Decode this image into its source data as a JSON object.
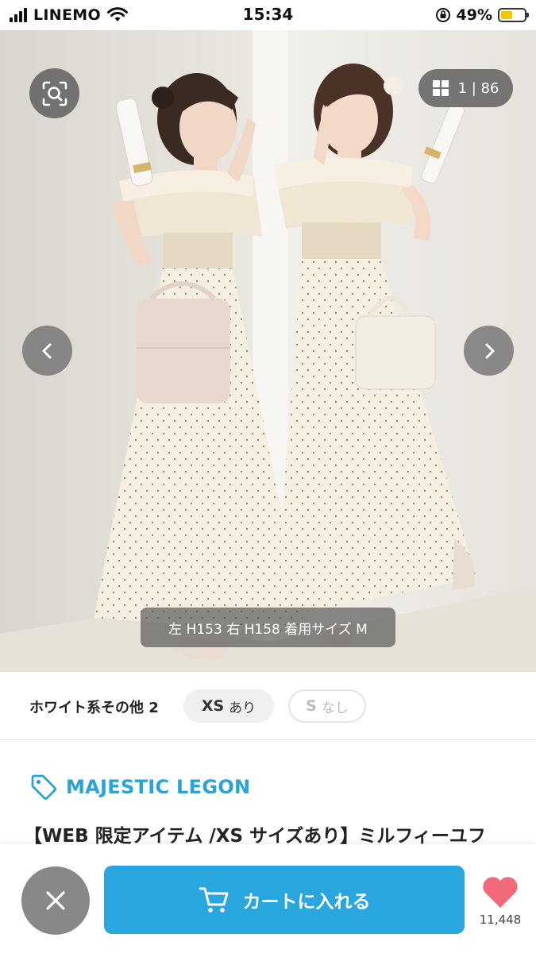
{
  "status_bar": {
    "carrier": "LINEMO",
    "time": "15:34",
    "battery_percent": "49%",
    "battery_level": 0.49,
    "battery_color": "#f5c400"
  },
  "gallery": {
    "counter": "1 | 86",
    "caption": "左 H153 右 H158 着用サイズ M",
    "search_icon": "image-search-icon",
    "prev_icon": "chevron-left-icon",
    "next_icon": "chevron-right-icon",
    "grid_icon": "grid-icon"
  },
  "variant": {
    "color_name": "ホワイト系その他 2",
    "sizes": [
      {
        "size": "XS",
        "status": "あり",
        "available": true
      },
      {
        "size": "S",
        "status": "なし",
        "available": false
      }
    ]
  },
  "product": {
    "brand": "MAJESTIC LEGON",
    "brand_icon": "tag-icon",
    "title": "【WEB 限定アイテム /XS サイズあり】ミルフィーユフ"
  },
  "actions": {
    "close_icon": "close-icon",
    "cart_label": "カートに入れる",
    "cart_icon": "cart-icon",
    "favorite_icon": "heart-icon",
    "favorite_count": "11,448"
  },
  "colors": {
    "accent": "#2aa6df",
    "brand_text": "#2aa3d9",
    "heart": "#f06a7a"
  }
}
